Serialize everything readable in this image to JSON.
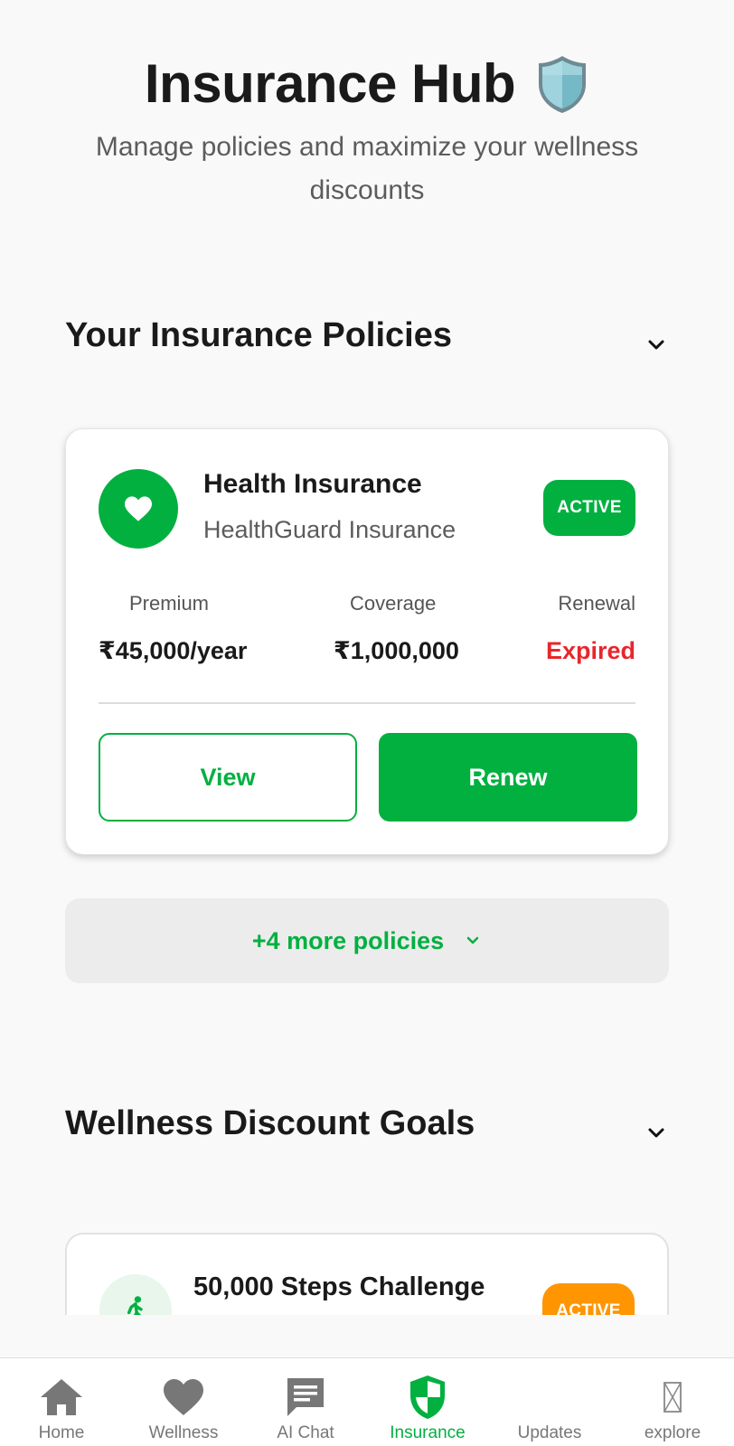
{
  "header": {
    "title": "Insurance Hub",
    "title_emoji": "shield-emoji",
    "subtitle": "Manage policies and maximize your wellness discounts"
  },
  "policies_section": {
    "title": "Your Insurance Policies",
    "toggle_icon": "chevron-down-icon",
    "policy": {
      "icon": "heart-icon",
      "name": "Health Insurance",
      "provider": "HealthGuard Insurance",
      "status": "ACTIVE",
      "premium_label": "Premium",
      "premium_value": "₹45,000/year",
      "coverage_label": "Coverage",
      "coverage_value": "₹1,000,000",
      "renewal_label": "Renewal",
      "renewal_value": "Expired",
      "view_button": "View",
      "renew_button": "Renew"
    },
    "more_policies": "+4 more policies"
  },
  "goals_section": {
    "title": "Wellness Discount Goals",
    "toggle_icon": "chevron-down-icon",
    "goal": {
      "icon": "walking-icon",
      "title": "50,000 Steps Challenge",
      "status": "ACTIVE"
    }
  },
  "bottom_nav": {
    "items": [
      {
        "label": "Home",
        "icon": "home-icon"
      },
      {
        "label": "Wellness",
        "icon": "heart-icon"
      },
      {
        "label": "AI Chat",
        "icon": "chat-icon"
      },
      {
        "label": "Insurance",
        "icon": "shield-icon",
        "active": true
      },
      {
        "label": "Updates",
        "icon": "updates-icon"
      },
      {
        "label": "explore",
        "icon": "explore-icon"
      }
    ]
  },
  "colors": {
    "primary_green": "#02b040",
    "expired_red": "#e8262b",
    "active_orange": "#ff9500",
    "background": "#f9f9f9"
  }
}
